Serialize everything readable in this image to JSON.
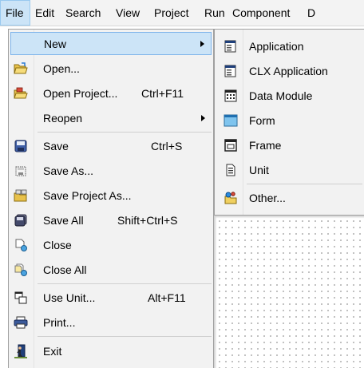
{
  "menubar": {
    "items": [
      {
        "label": "File"
      },
      {
        "label": "Edit"
      },
      {
        "label": "Search"
      },
      {
        "label": "View"
      },
      {
        "label": "Project"
      },
      {
        "label": "Run"
      },
      {
        "label": "Component"
      },
      {
        "label": "D"
      }
    ]
  },
  "file_menu": {
    "items": [
      {
        "label": "New",
        "shortcut": "",
        "icon": "none",
        "submenu": true
      },
      {
        "label": "Open...",
        "shortcut": "",
        "icon": "open-folder-icon"
      },
      {
        "label": "Open Project...",
        "shortcut": "Ctrl+F11",
        "icon": "open-project-icon"
      },
      {
        "label": "Reopen",
        "shortcut": "",
        "icon": "none",
        "submenu": true
      },
      {
        "label": "Save",
        "shortcut": "Ctrl+S",
        "icon": "save-icon"
      },
      {
        "label": "Save As...",
        "shortcut": "",
        "icon": "save-as-icon"
      },
      {
        "label": "Save Project As...",
        "shortcut": "",
        "icon": "save-project-as-icon"
      },
      {
        "label": "Save All",
        "shortcut": "Shift+Ctrl+S",
        "icon": "save-all-icon"
      },
      {
        "label": "Close",
        "shortcut": "",
        "icon": "close-file-icon"
      },
      {
        "label": "Close All",
        "shortcut": "",
        "icon": "close-all-icon"
      },
      {
        "label": "Use Unit...",
        "shortcut": "Alt+F11",
        "icon": "use-unit-icon"
      },
      {
        "label": "Print...",
        "shortcut": "",
        "icon": "printer-icon"
      },
      {
        "label": "Exit",
        "shortcut": "",
        "icon": "exit-icon"
      }
    ]
  },
  "new_submenu": {
    "items": [
      {
        "label": "Application",
        "icon": "application-icon"
      },
      {
        "label": "CLX Application",
        "icon": "clx-application-icon"
      },
      {
        "label": "Data Module",
        "icon": "data-module-icon"
      },
      {
        "label": "Form",
        "icon": "form-icon"
      },
      {
        "label": "Frame",
        "icon": "frame-icon"
      },
      {
        "label": "Unit",
        "icon": "unit-icon"
      },
      {
        "label": "Other...",
        "icon": "other-icon"
      }
    ]
  },
  "colors": {
    "menu_bg": "#f2f2f2",
    "highlight_bg": "#cce4f7",
    "highlight_border": "#7eb4ea"
  }
}
